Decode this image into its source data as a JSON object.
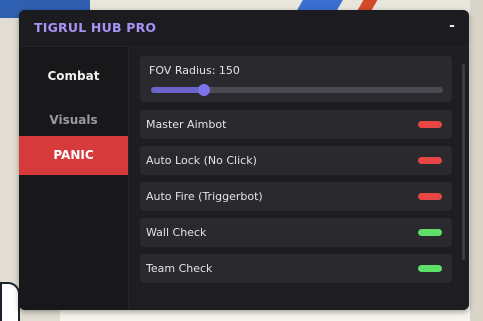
{
  "window": {
    "title": "TIGRUL HUB PRO",
    "minimize_label": "-"
  },
  "sidebar": {
    "items": [
      {
        "label": "Combat"
      },
      {
        "label": "Visuals"
      },
      {
        "label": "PANIC"
      }
    ]
  },
  "fov": {
    "label": "FOV Radius: 150",
    "slider_fraction": 0.18
  },
  "toggles": [
    {
      "label": "Master Aimbot",
      "enabled": false,
      "color": "#e84545"
    },
    {
      "label": "Auto Lock (No Click)",
      "enabled": false,
      "color": "#e84545"
    },
    {
      "label": "Auto Fire (Triggerbot)",
      "enabled": false,
      "color": "#e84545"
    },
    {
      "label": "Wall Check",
      "enabled": true,
      "color": "#5ee068"
    },
    {
      "label": "Team Check",
      "enabled": true,
      "color": "#5ee068"
    }
  ],
  "colors": {
    "accent": "#a792f5",
    "panic": "#d63a3a",
    "slider": "#7c72ea"
  }
}
